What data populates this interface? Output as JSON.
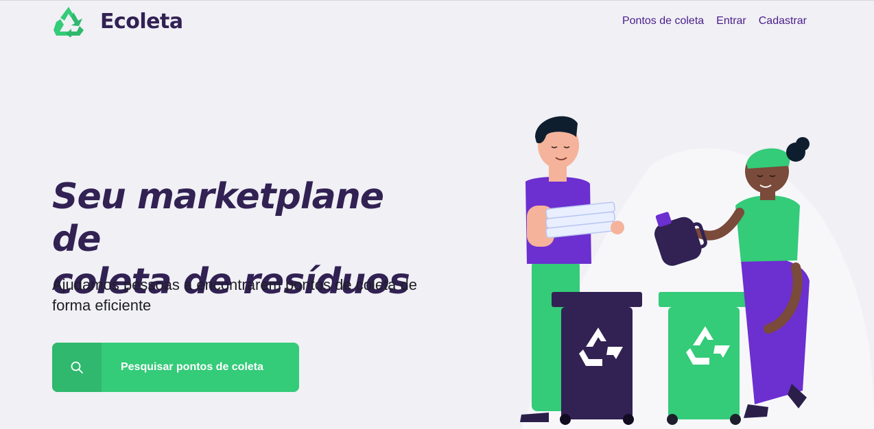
{
  "app": {
    "name": "Ecoleta"
  },
  "nav": {
    "items": [
      "Pontos de coleta",
      "Entrar",
      "Cadastrar"
    ]
  },
  "hero": {
    "title_line1": "Seu marketplane de",
    "title_line2": "coleta de resíduos",
    "subtitle": "Ajudamos pessoas a encontrarem pontos de coleta de forma eficiente"
  },
  "search": {
    "button_label": "Pesquisar pontos de coleta",
    "icon": "search-icon"
  },
  "illustration": {
    "icons": [
      "recycle-logo-icon",
      "recycle-bin-dark",
      "recycle-bin-green",
      "person-holding-paper",
      "person-pouring-bottle"
    ]
  },
  "colors": {
    "primary": "#34cb79",
    "primary_dark": "#2fb86e",
    "title": "#322153",
    "nav": "#4a1d8a",
    "background": "#f0f0f5",
    "purple": "#6c2fd0"
  }
}
